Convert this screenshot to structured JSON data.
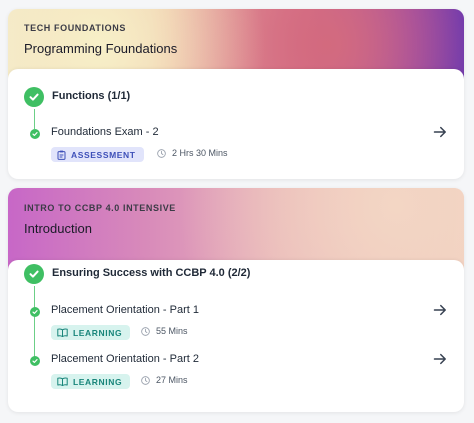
{
  "courses": [
    {
      "tagline": "TECH FOUNDATIONS",
      "title": "Programming Foundations",
      "topic": "Functions (1/1)",
      "items": [
        {
          "title": "Foundations Exam - 2",
          "badge": "ASSESSMENT",
          "duration": "2 Hrs 30 Mins",
          "badge_icon": "clipboard-icon"
        }
      ]
    },
    {
      "tagline": "INTRO TO CCBP 4.0 INTENSIVE",
      "title": "Introduction",
      "topic": "Ensuring Success with CCBP 4.0 (2/2)",
      "items": [
        {
          "title": "Placement Orientation - Part 1",
          "badge": "LEARNING",
          "duration": "55 Mins",
          "badge_icon": "book-icon"
        },
        {
          "title": "Placement Orientation - Part 2",
          "badge": "LEARNING",
          "duration": "27 Mins",
          "badge_icon": "book-icon"
        }
      ]
    }
  ],
  "colors": {
    "check_green": "#3fbf63",
    "assessment_badge_bg": "#e1e4fb",
    "learning_badge_bg": "#d7f3ee"
  }
}
